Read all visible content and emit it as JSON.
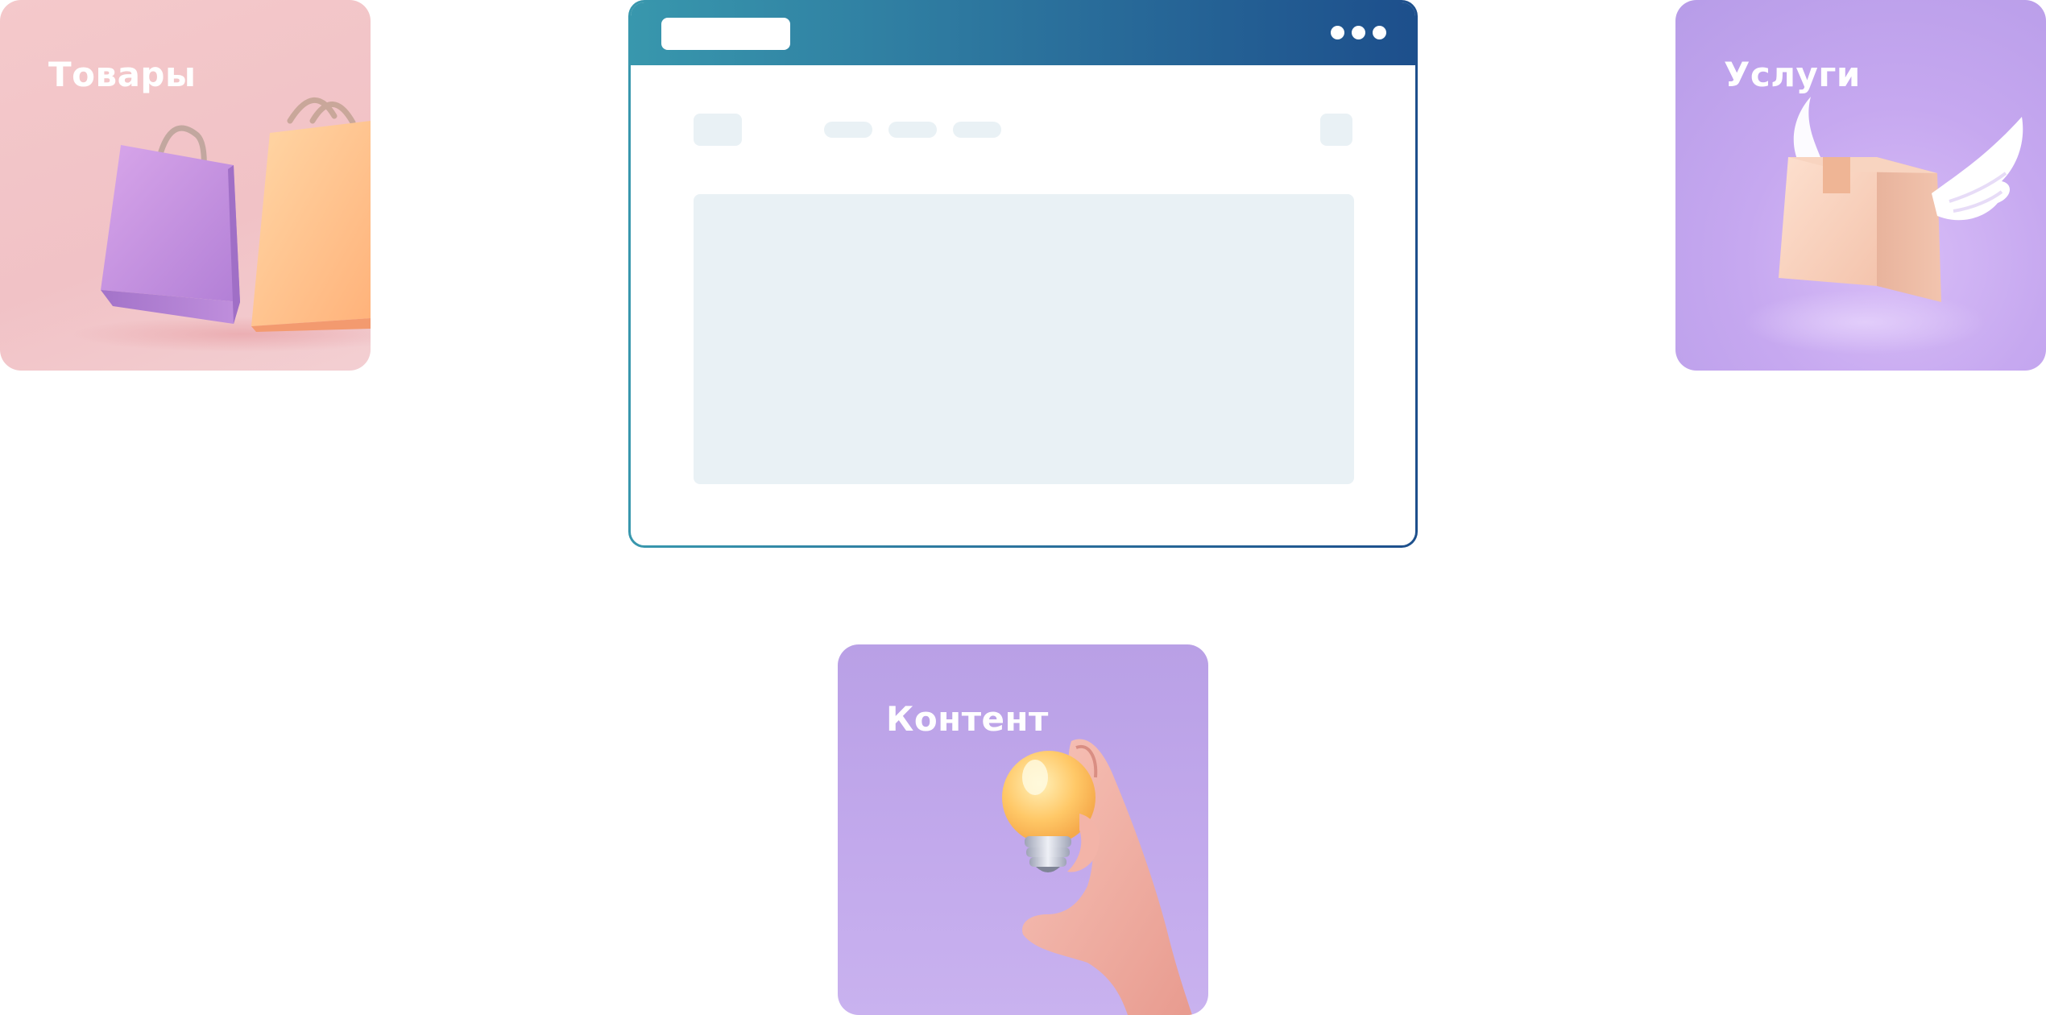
{
  "cards": {
    "goods": {
      "label": "Товары"
    },
    "services": {
      "label": "Услуги"
    },
    "content": {
      "label": "Контент"
    }
  },
  "colors": {
    "goods_card_bg": "#f2c6c9",
    "services_card_bg": "#c6a8f0",
    "content_card_bg": "#c0a6ea",
    "browser_gradient_start": "#3897ad",
    "browser_gradient_end": "#1d4f8c",
    "placeholder": "#e9f1f5"
  },
  "icons": {
    "goods": "shopping-bags-icon",
    "services": "winged-box-icon",
    "content": "lightbulb-hand-icon",
    "browser_menu": "more-dots-icon"
  }
}
